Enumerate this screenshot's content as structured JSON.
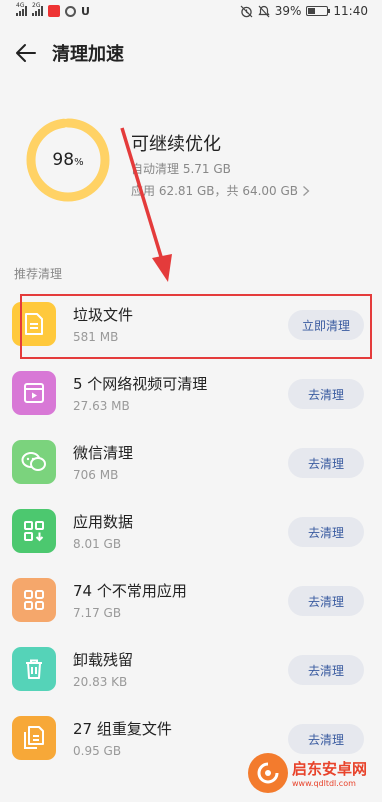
{
  "status_bar": {
    "network1": "4G",
    "network2": "2G",
    "battery": "39%",
    "battery_level": 0.39,
    "time": "11:40"
  },
  "header": {
    "title": "清理加速",
    "back_icon": "arrow-left-icon"
  },
  "summary": {
    "percent_value": "98",
    "percent_sign": "%",
    "percent_fraction": 0.98,
    "title": "可继续优化",
    "auto_clean": "自动清理 5.71 GB",
    "usage": "应用 62.81 GB，共 64.00 GB",
    "ring_color": "#ffd265"
  },
  "section_label": "推荐清理",
  "items": [
    {
      "name": "垃圾文件",
      "size": "581 MB",
      "button": "立即清理",
      "icon": "document-icon",
      "color": "#ffc93c"
    },
    {
      "name": "5 个网络视频可清理",
      "size": "27.63 MB",
      "button": "去清理",
      "icon": "video-icon",
      "color": "#d878d6"
    },
    {
      "name": "微信清理",
      "size": "706 MB",
      "button": "去清理",
      "icon": "wechat-icon",
      "color": "#7bd37d"
    },
    {
      "name": "应用数据",
      "size": "8.01 GB",
      "button": "去清理",
      "icon": "app-data-icon",
      "color": "#4cc86f"
    },
    {
      "name": "74 个不常用应用",
      "size": "7.17 GB",
      "button": "去清理",
      "icon": "apps-grid-icon",
      "color": "#f5a76b"
    },
    {
      "name": "卸载残留",
      "size": "20.83 KB",
      "button": "去清理",
      "icon": "trash-icon",
      "color": "#55d3b8"
    },
    {
      "name": "27 组重复文件",
      "size": "0.95 GB",
      "button": "去清理",
      "icon": "duplicate-files-icon",
      "color": "#f7a838"
    }
  ],
  "annotation_color": "#e43b3b",
  "watermark": {
    "name": "启东安卓网",
    "url": "www.qdltdl.com"
  }
}
